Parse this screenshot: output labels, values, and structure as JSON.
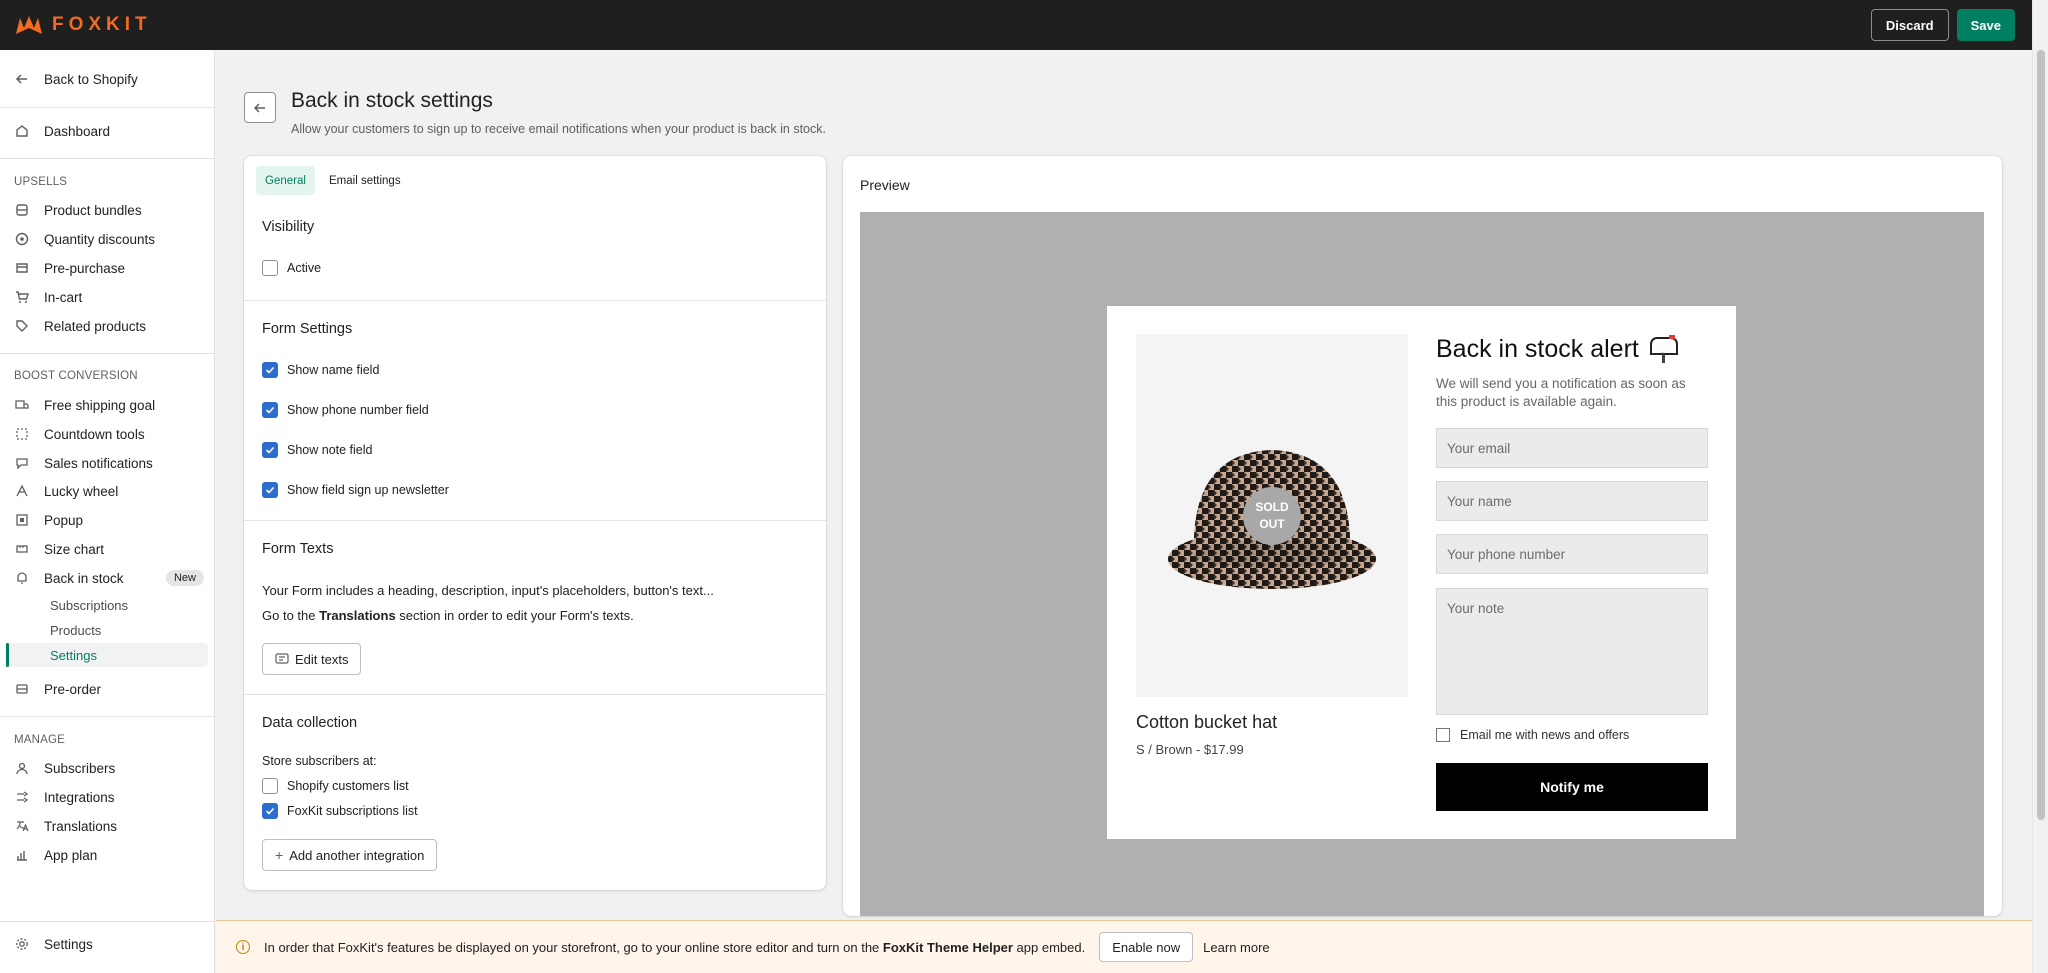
{
  "topbar": {
    "brand": "FOXKIT",
    "discard_label": "Discard",
    "save_label": "Save"
  },
  "sidebar": {
    "back_label": "Back to Shopify",
    "dashboard_label": "Dashboard",
    "upsells_heading": "UPSELLS",
    "upsells": [
      "Product bundles",
      "Quantity discounts",
      "Pre-purchase",
      "In-cart",
      "Related products"
    ],
    "boost_heading": "BOOST CONVERSION",
    "boost": [
      "Free shipping goal",
      "Countdown tools",
      "Sales notifications",
      "Lucky wheel",
      "Popup",
      "Size chart",
      "Back in stock"
    ],
    "new_badge": "New",
    "back_in_stock_sub": [
      "Subscriptions",
      "Products",
      "Settings"
    ],
    "preorder_label": "Pre-order",
    "manage_heading": "MANAGE",
    "manage": [
      "Subscribers",
      "Integrations",
      "Translations",
      "App plan"
    ],
    "settings_label": "Settings"
  },
  "header": {
    "title": "Back in stock settings",
    "subtitle": "Allow your customers to sign up to receive email notifications when your product is back in stock."
  },
  "tabs": [
    "General",
    "Email settings"
  ],
  "visibility": {
    "heading": "Visibility",
    "active_label": "Active",
    "active_checked": false
  },
  "form_settings": {
    "heading": "Form Settings",
    "options": [
      {
        "label": "Show name field",
        "checked": true
      },
      {
        "label": "Show phone number field",
        "checked": true
      },
      {
        "label": "Show note field",
        "checked": true
      },
      {
        "label": "Show field sign up newsletter",
        "checked": true
      }
    ]
  },
  "form_texts": {
    "heading": "Form Texts",
    "line1": "Your Form includes a heading, description, input's placeholders, button's text...",
    "line2_pre": "Go to the ",
    "line2_bold": "Translations",
    "line2_post": " section in order to edit your Form's texts.",
    "edit_button": "Edit texts"
  },
  "data_collection": {
    "heading": "Data collection",
    "store_label": "Store subscribers at:",
    "options": [
      {
        "label": "Shopify customers list",
        "checked": false
      },
      {
        "label": "FoxKit subscriptions list",
        "checked": true
      }
    ],
    "add_button": "Add another integration"
  },
  "preview": {
    "label": "Preview",
    "sold_out_line1": "SOLD",
    "sold_out_line2": "OUT",
    "product_name": "Cotton bucket hat",
    "product_variant": "S / Brown - $17.99",
    "title": "Back in stock alert",
    "title_emoji": "📭",
    "description": "We will send you a notification as soon as this product is available again.",
    "email_placeholder": "Your email",
    "name_placeholder": "Your name",
    "phone_placeholder": "Your phone number",
    "note_placeholder": "Your note",
    "newsletter_label": "Email me with news and offers",
    "notify_button": "Notify me"
  },
  "banner": {
    "text_pre": "In order that FoxKit's features be displayed on your storefront, go to your online store editor and turn on the ",
    "text_bold": "FoxKit Theme Helper",
    "text_post": " app embed.",
    "enable_button": "Enable now",
    "learn_more": "Learn more"
  },
  "colors": {
    "brand_orange": "#f26b21",
    "primary_green": "#008060",
    "checkbox_blue": "#2c6ecb"
  }
}
